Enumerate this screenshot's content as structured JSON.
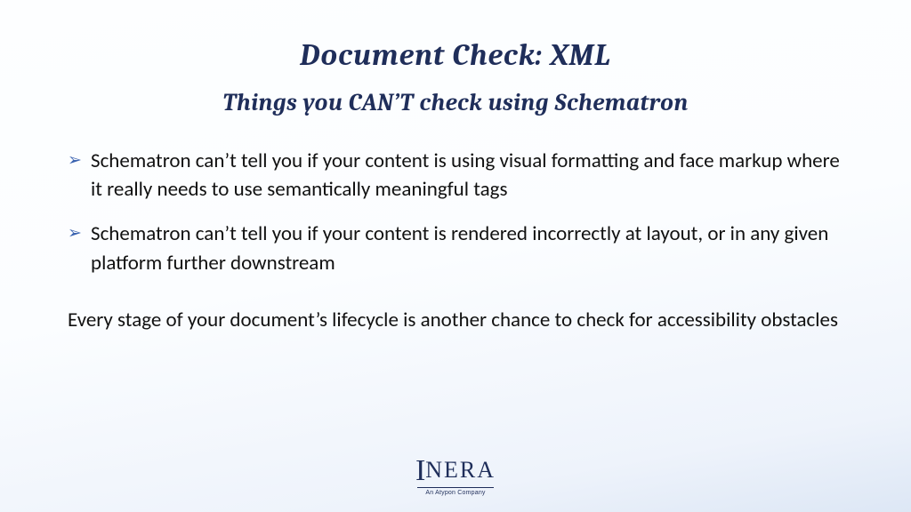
{
  "slide": {
    "title": "Document Check: XML",
    "subtitle": "Things you CAN’T check using Schematron",
    "bullets": [
      "Schematron can’t tell you if your content is using visual formatting and face markup where it really needs to use semantically meaningful tags",
      "Schematron can’t tell you if your content is rendered incorrectly at layout, or in any given platform further downstream"
    ],
    "closing": "Every stage of your document’s lifecycle is another chance to check for accessibility obstacles"
  },
  "logo": {
    "name": "INERA",
    "tagline": "An Atypon Company"
  }
}
